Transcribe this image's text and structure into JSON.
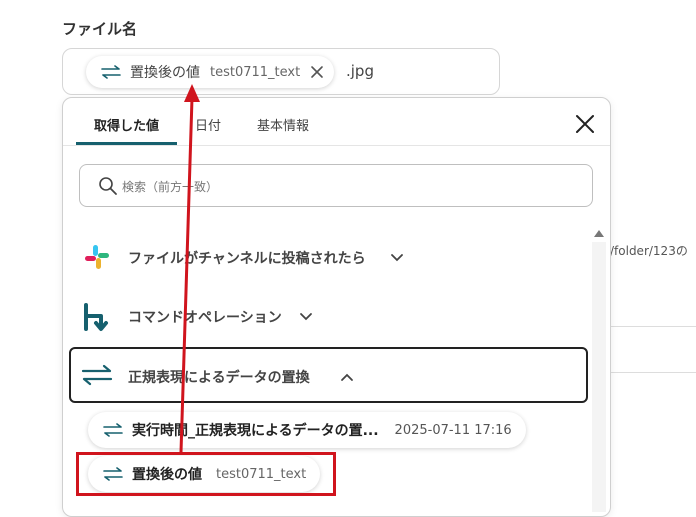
{
  "field": {
    "label": "ファイル名",
    "chip_name": "置換後の値",
    "chip_value": "test0711_text",
    "extension": ".jpg"
  },
  "background": {
    "path_fragment": "/folder/123の"
  },
  "panel": {
    "tabs": [
      {
        "label": "取得した値",
        "active": true
      },
      {
        "label": "日付",
        "active": false
      },
      {
        "label": "基本情報",
        "active": false
      }
    ],
    "search_placeholder": "検索（前方一致）",
    "sections": [
      {
        "label": "ファイルがチャンネルに投稿されたら",
        "icon": "slack-icon",
        "expanded": false
      },
      {
        "label": "コマンドオペレーション",
        "icon": "command-operation-icon",
        "expanded": false
      },
      {
        "label": "正規表現によるデータの置換",
        "icon": "swap-arrows-icon",
        "expanded": true
      }
    ],
    "results": [
      {
        "name": "実行時間_正規表現によるデータの置...",
        "value": "2025-07-11 17:16"
      },
      {
        "name": "置換後の値",
        "value": "test0711_text"
      }
    ]
  },
  "colors": {
    "accent": "#16606e",
    "annotation_red": "#d0141d"
  }
}
